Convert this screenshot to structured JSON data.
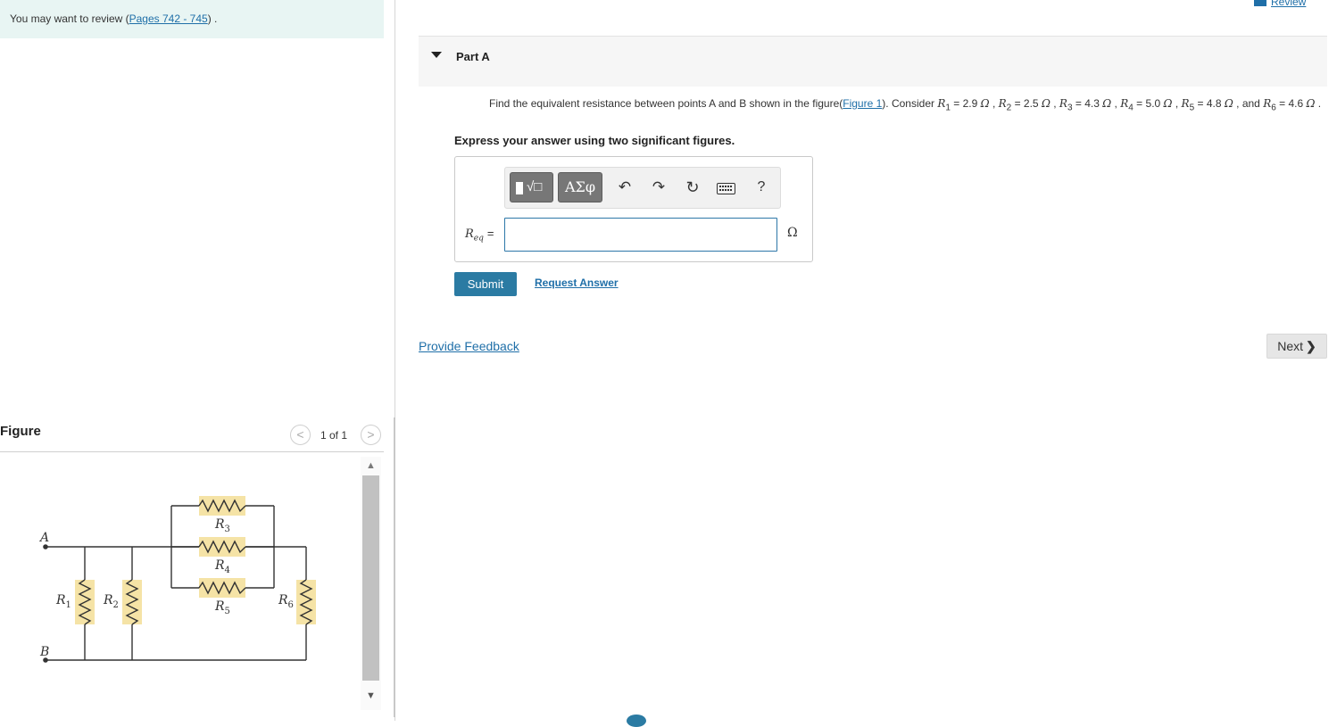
{
  "review_banner": {
    "prefix": "You may want to review (",
    "link": "Pages 742 - 745",
    "suffix": ") ."
  },
  "top_links": {
    "review": "Review"
  },
  "part": {
    "title": "Part A"
  },
  "question": {
    "text_start": "Find the equivalent resistance between points A and B shown in the figure(",
    "figure_link": "Figure 1",
    "text_mid": "). Consider ",
    "values": [
      {
        "name": "R",
        "sub": "1",
        "value": "2.9"
      },
      {
        "name": "R",
        "sub": "2",
        "value": "2.5"
      },
      {
        "name": "R",
        "sub": "3",
        "value": "4.3"
      },
      {
        "name": "R",
        "sub": "4",
        "value": "5.0"
      },
      {
        "name": "R",
        "sub": "5",
        "value": "4.8"
      }
    ],
    "and_text": "and",
    "last": {
      "name": "R",
      "sub": "6",
      "value": "4.6"
    },
    "unit": "Ω"
  },
  "instruction": "Express your answer using two significant figures.",
  "toolbar": {
    "templates_glyph": "√□",
    "greek_label": "ΑΣφ",
    "undo_icon": "↶",
    "redo_icon": "↷",
    "reset_icon": "↻",
    "help_label": "?"
  },
  "answer": {
    "label_main": "R",
    "label_sub": "eq",
    "label_eq": "=",
    "value": "",
    "unit": "Ω"
  },
  "buttons": {
    "submit": "Submit",
    "request_answer": "Request Answer",
    "provide_feedback": "Provide Feedback",
    "next": "Next",
    "next_chevron": "❯"
  },
  "figure": {
    "title": "Figure",
    "counter": "1 of 1",
    "prev_icon": "<",
    "next_icon": ">",
    "labels": {
      "a": "A",
      "b": "B",
      "r1": "R",
      "r1_sub": "1",
      "r2": "R",
      "r2_sub": "2",
      "r3": "R",
      "r3_sub": "3",
      "r4": "R",
      "r4_sub": "4",
      "r5": "R",
      "r5_sub": "5",
      "r6": "R",
      "r6_sub": "6"
    }
  },
  "colors": {
    "accent": "#2b7ba3",
    "link": "#1f6fa8",
    "banner_bg": "#e8f5f3",
    "resistor_bg": "#f5e3a6"
  }
}
